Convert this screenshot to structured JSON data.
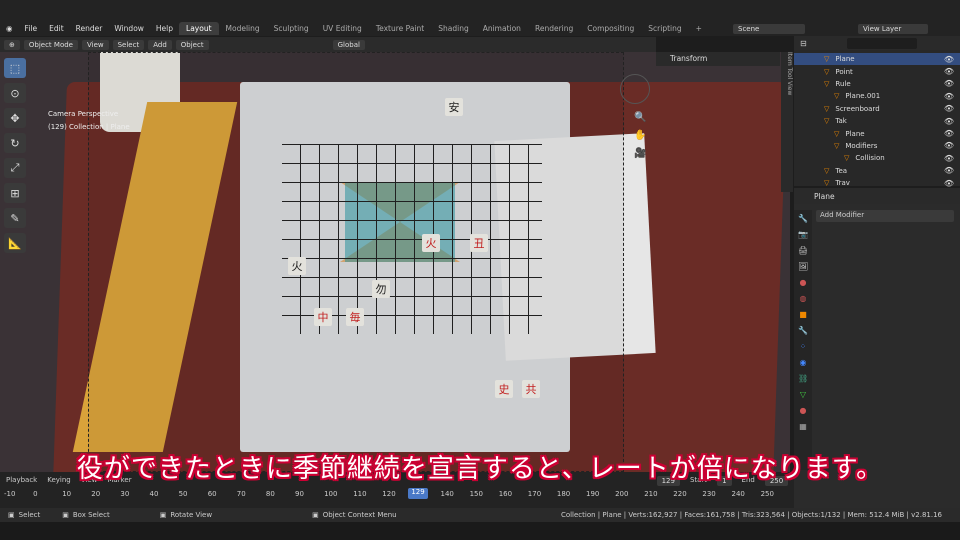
{
  "menu": [
    "File",
    "Edit",
    "Render",
    "Window",
    "Help"
  ],
  "workspaces": [
    "Layout",
    "Modeling",
    "Sculpting",
    "UV Editing",
    "Texture Paint",
    "Shading",
    "Animation",
    "Rendering",
    "Compositing",
    "Scripting"
  ],
  "scene": "Scene",
  "view_layer": "View Layer",
  "header": {
    "mode": "Object Mode",
    "view": "View",
    "select": "Select",
    "add": "Add",
    "object": "Object",
    "orientation": "Global"
  },
  "viewport": {
    "perspective": "Camera Perspective",
    "collection": "(129) Collection | Plane"
  },
  "npanel": {
    "title": "Transform",
    "tabs": [
      "Item",
      "Tool",
      "View"
    ]
  },
  "outliner": [
    {
      "name": "Plane",
      "depth": 1,
      "sel": true
    },
    {
      "name": "Point",
      "depth": 1
    },
    {
      "name": "Rule",
      "depth": 1
    },
    {
      "name": "Plane.001",
      "depth": 2
    },
    {
      "name": "Screenboard",
      "depth": 1
    },
    {
      "name": "Tak",
      "depth": 1
    },
    {
      "name": "Plane",
      "depth": 2
    },
    {
      "name": "Modifiers",
      "depth": 2
    },
    {
      "name": "Collision",
      "depth": 3
    },
    {
      "name": "Tea",
      "depth": 1
    },
    {
      "name": "Trav",
      "depth": 1
    }
  ],
  "properties": {
    "object": "Plane",
    "add_modifier": "Add Modifier"
  },
  "timeline": {
    "playback": "Playback",
    "keying": "Keying",
    "view": "View",
    "marker": "Marker",
    "current": "129",
    "start_label": "Start",
    "start": "1",
    "end_label": "End",
    "end": "250",
    "ticks": [
      "-10",
      "0",
      "10",
      "20",
      "30",
      "40",
      "50",
      "60",
      "70",
      "80",
      "90",
      "100",
      "110",
      "120",
      "129",
      "140",
      "150",
      "160",
      "170",
      "180",
      "190",
      "200",
      "210",
      "220",
      "230",
      "240",
      "250"
    ]
  },
  "status": {
    "select": "Select",
    "box": "Box Select",
    "rotate": "Rotate View",
    "context": "Object Context Menu",
    "stats": "Collection | Plane | Verts:162,927 | Faces:161,758 | Tris:323,564 | Objects:1/132 | Mem: 512.4 MiB | v2.81.16"
  },
  "subtitle": "役ができたときに季節継続を宣言すると、レートが倍になります。",
  "colors": {
    "selected": "#334d80",
    "accent": "#4a79c7",
    "subtitle_outline": "#c03"
  }
}
